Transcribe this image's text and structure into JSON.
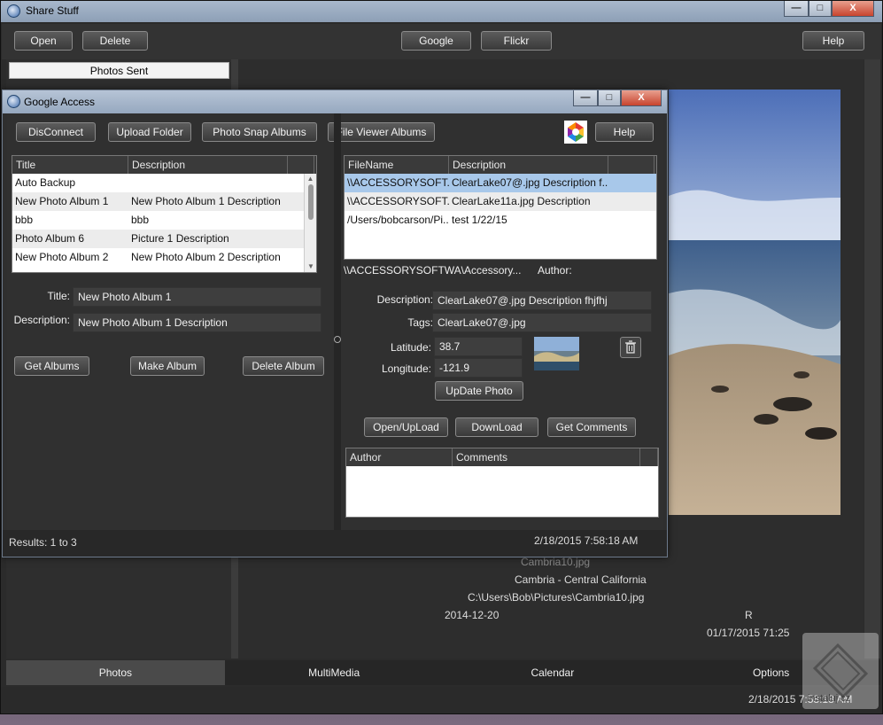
{
  "app": {
    "title": "Share Stuff",
    "minimize": "—",
    "maximize": "□",
    "close": "X"
  },
  "toolbar": {
    "open": "Open",
    "delete": "Delete",
    "google": "Google",
    "flickr": "Flickr",
    "help": "Help"
  },
  "left_panel": {
    "photos_sent": "Photos Sent"
  },
  "photo_info": {
    "filename": "Cambria10.jpg",
    "location": "Cambria - Central California",
    "path": "C:\\Users\\Bob\\Pictures\\Cambria10.jpg",
    "date": "2014-12-20",
    "flag": "R",
    "datetime": "01/17/2015 71:25"
  },
  "tabs": [
    "Photos",
    "MultiMedia",
    "Calendar",
    "Options"
  ],
  "status": {
    "datetime": "2/18/2015 7:58:18 AM"
  },
  "dialog": {
    "title": "Google Access",
    "buttons": {
      "disconnect": "DisConnect",
      "upload_folder": "Upload Folder",
      "photo_snap_albums": "Photo Snap Albums",
      "file_viewer_albums": "File Viewer Albums",
      "help": "Help"
    },
    "albums": {
      "headers": [
        "Title",
        "Description"
      ],
      "rows": [
        [
          "Auto Backup",
          ""
        ],
        [
          "New Photo Album 1",
          "New Photo Album 1 Description"
        ],
        [
          "bbb",
          "bbb"
        ],
        [
          "Photo Album 6",
          "Picture 1 Description"
        ],
        [
          "New Photo Album 2",
          "New Photo Album 2 Description"
        ]
      ]
    },
    "album_form": {
      "title_label": "Title:",
      "title_value": "New Photo Album 1",
      "description_label": "Description:",
      "description_value": "New Photo Album 1 Description"
    },
    "album_buttons": {
      "get_albums": "Get Albums",
      "make_album": "Make Album",
      "delete_album": "Delete Album"
    },
    "files": {
      "headers": [
        "FileName",
        "Description"
      ],
      "rows": [
        [
          "\\\\ACCESSORYSOFT...",
          "ClearLake07@.jpg Description f..."
        ],
        [
          "\\\\ACCESSORYSOFT...",
          "ClearLake11a.jpg Description"
        ],
        [
          "/Users/bobcarson/Pi...",
          "test 1/22/15"
        ]
      ]
    },
    "file_path": "\\\\ACCESSORYSOFTWA\\Accessory...",
    "author_label": "Author:",
    "photo_form": {
      "description_label": "Description:",
      "description_value": "ClearLake07@.jpg Description fhjfhj",
      "tags_label": "Tags:",
      "tags_value": "ClearLake07@.jpg",
      "latitude_label": "Latitude:",
      "latitude_value": "38.7",
      "longitude_label": "Longitude:",
      "longitude_value": "-121.9"
    },
    "update_photo": "UpDate Photo",
    "file_buttons": {
      "open_upload": "Open/UpLoad",
      "download": "DownLoad",
      "get_comments": "Get Comments"
    },
    "comments": {
      "headers": [
        "Author",
        "Comments"
      ]
    },
    "status": {
      "results": "Results: 1 to 3",
      "datetime": "2/18/2015 7:58:18 AM"
    }
  },
  "watermark": "instaluj.cz"
}
